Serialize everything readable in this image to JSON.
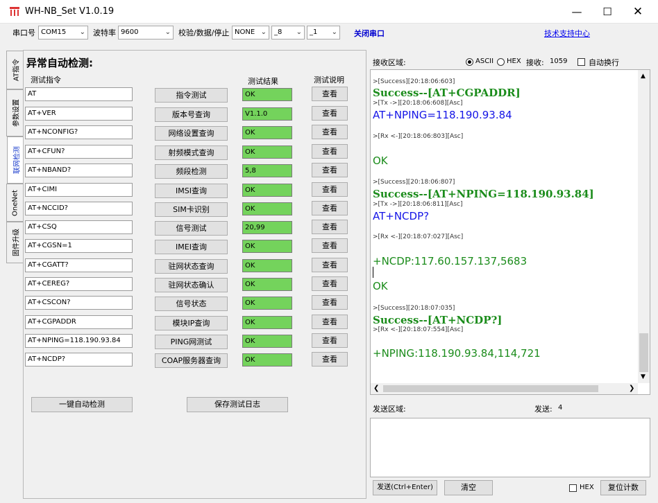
{
  "window": {
    "title": "WH-NB_Set V1.0.19"
  },
  "toolbar": {
    "port_label": "串口号",
    "port_value": "COM15",
    "baud_label": "波特率",
    "baud_value": "9600",
    "parity_label": "校验/数据/停止",
    "parity_value": "NONE",
    "databits_value": "_8",
    "stopbits_value": "_1",
    "close_port": "关闭串口",
    "support": "技术支持中心"
  },
  "tabs": [
    "AT指令",
    "参数设置",
    "联网检测",
    "OneNet",
    "固件升级"
  ],
  "active_tab": 2,
  "panel": {
    "title": "异常自动检测:",
    "col_command": "测试指令",
    "col_result": "测试结果",
    "col_desc": "测试说明",
    "auto_button": "一键自动检测",
    "save_button": "保存测试日志"
  },
  "rows": [
    {
      "cmd": "AT",
      "test": "指令测试",
      "result": "OK",
      "view": "查看"
    },
    {
      "cmd": "AT+VER",
      "test": "版本号查询",
      "result": "V1.1.0",
      "view": "查看"
    },
    {
      "cmd": "AT+NCONFIG?",
      "test": "网络设置查询",
      "result": "OK",
      "view": "查看"
    },
    {
      "cmd": "AT+CFUN?",
      "test": "射频模式查询",
      "result": "OK",
      "view": "查看"
    },
    {
      "cmd": "AT+NBAND?",
      "test": "频段检测",
      "result": "5,8",
      "view": "查看"
    },
    {
      "cmd": "AT+CIMI",
      "test": "IMSI查询",
      "result": "OK",
      "view": "查看"
    },
    {
      "cmd": "AT+NCCID?",
      "test": "SIM卡识别",
      "result": "OK",
      "view": "查看"
    },
    {
      "cmd": "AT+CSQ",
      "test": "信号测试",
      "result": "20,99",
      "view": "查看"
    },
    {
      "cmd": "AT+CGSN=1",
      "test": "IMEI查询",
      "result": "OK",
      "view": "查看"
    },
    {
      "cmd": "AT+CGATT?",
      "test": "驻网状态查询",
      "result": "OK",
      "view": "查看"
    },
    {
      "cmd": "AT+CEREG?",
      "test": "驻网状态确认",
      "result": "OK",
      "view": "查看"
    },
    {
      "cmd": "AT+CSCON?",
      "test": "信号状态",
      "result": "OK",
      "view": "查看"
    },
    {
      "cmd": "AT+CGPADDR",
      "test": "模块IP查询",
      "result": "OK",
      "view": "查看"
    },
    {
      "cmd": "AT+NPING=118.190.93.84",
      "test": "PING网测试",
      "result": "OK",
      "view": "查看"
    },
    {
      "cmd": "AT+NCDP?",
      "test": "COAP服务器查询",
      "result": "OK",
      "view": "查看"
    }
  ],
  "receive": {
    "label": "接收区域:",
    "ascii": "ASCII",
    "hex": "HEX",
    "count_label": "接收:",
    "count": "1059",
    "autowrap": "自动换行",
    "log": [
      {
        "kind": "meta",
        "text": ">[Success][20:18:06:603]"
      },
      {
        "kind": "succ",
        "text": "Success--[AT+CGPADDR]"
      },
      {
        "kind": "meta",
        "text": ">[Tx ->][20:18:06:608][Asc]"
      },
      {
        "kind": "tx",
        "text": "AT+NPING=118.190.93.84"
      },
      {
        "kind": "meta",
        "text": ">[Rx <-][20:18:06:803][Asc]"
      },
      {
        "kind": "ok",
        "text": "OK"
      },
      {
        "kind": "meta",
        "text": ">[Success][20:18:06:807]"
      },
      {
        "kind": "succ",
        "text": "Success--[AT+NPING=118.190.93.84]"
      },
      {
        "kind": "meta",
        "text": ">[Tx ->][20:18:06:811][Asc]"
      },
      {
        "kind": "tx",
        "text": "AT+NCDP?"
      },
      {
        "kind": "meta",
        "text": ">[Rx <-][20:18:07:027][Asc]"
      },
      {
        "kind": "ok",
        "text": "+NCDP:117.60.157.137,5683"
      },
      {
        "kind": "ok",
        "text": "OK"
      },
      {
        "kind": "meta",
        "text": ">[Success][20:18:07:035]"
      },
      {
        "kind": "succ",
        "text": "Success--[AT+NCDP?]"
      },
      {
        "kind": "meta",
        "text": ">[Rx <-][20:18:07:554][Asc]"
      },
      {
        "kind": "ok",
        "text": "+NPING:118.190.93.84,114,721"
      }
    ]
  },
  "send": {
    "label": "发送区域:",
    "count_label": "发送:",
    "count": "4",
    "send_button": "发送(Ctrl+Enter)",
    "clear_button": "清空",
    "hex": "HEX",
    "reset_button": "复位计数"
  },
  "colors": {
    "result_green": "#74d35c",
    "tx_blue": "#1515e6",
    "ok_green": "#1b8c1b"
  }
}
